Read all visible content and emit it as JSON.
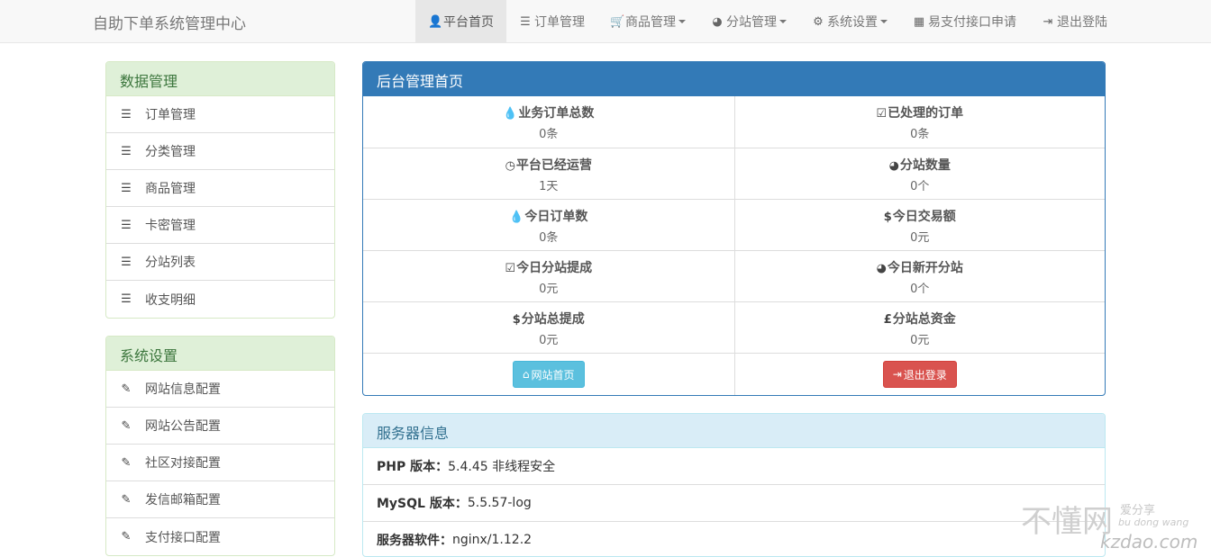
{
  "brand": "自助下单系统管理中心",
  "nav": [
    {
      "label": "平台首页",
      "icon": "user-icon",
      "glyph": "👤",
      "active": true,
      "dropdown": false
    },
    {
      "label": "订单管理",
      "icon": "list-icon",
      "glyph": "☰",
      "active": false,
      "dropdown": false
    },
    {
      "label": "商品管理",
      "icon": "shopping-cart-icon",
      "glyph": "🛒",
      "active": false,
      "dropdown": true
    },
    {
      "label": "分站管理",
      "icon": "globe-icon",
      "glyph": "◕",
      "active": false,
      "dropdown": true
    },
    {
      "label": "系统设置",
      "icon": "cog-icon",
      "glyph": "⚙",
      "active": false,
      "dropdown": true
    },
    {
      "label": "易支付接口申请",
      "icon": "th-large-icon",
      "glyph": "▦",
      "active": false,
      "dropdown": false
    },
    {
      "label": "退出登陆",
      "icon": "log-out-icon",
      "glyph": "⇥",
      "active": false,
      "dropdown": false
    }
  ],
  "sidebar": {
    "data_panel": {
      "title": "数据管理",
      "icon": "list-icon",
      "items": [
        "订单管理",
        "分类管理",
        "商品管理",
        "卡密管理",
        "分站列表",
        "收支明细"
      ]
    },
    "settings_panel": {
      "title": "系统设置",
      "icon": "edit-icon",
      "items": [
        "网站信息配置",
        "网站公告配置",
        "社区对接配置",
        "发信邮箱配置",
        "支付接口配置"
      ]
    }
  },
  "main": {
    "title": "后台管理首页",
    "stats": [
      [
        {
          "icon": "tint-icon",
          "glyph": "💧",
          "label": "业务订单总数",
          "value": "0条"
        },
        {
          "icon": "check-icon",
          "glyph": "☑",
          "label": "已处理的订单",
          "value": "0条"
        }
      ],
      [
        {
          "icon": "clock-icon",
          "glyph": "◷",
          "label": "平台已经运营",
          "value": "1天"
        },
        {
          "icon": "globe-icon",
          "glyph": "◕",
          "label": "分站数量",
          "value": "0个"
        }
      ],
      [
        {
          "icon": "tint-icon",
          "glyph": "💧",
          "label": "今日订单数",
          "value": "0条"
        },
        {
          "icon": "usd-icon",
          "glyph": "$",
          "label": "今日交易额",
          "value": "0元"
        }
      ],
      [
        {
          "icon": "check-icon",
          "glyph": "☑",
          "label": "今日分站提成",
          "value": "0元"
        },
        {
          "icon": "globe-icon",
          "glyph": "◕",
          "label": "今日新开分站",
          "value": "0个"
        }
      ],
      [
        {
          "icon": "usd-icon",
          "glyph": "$",
          "label": "分站总提成",
          "value": "0元"
        },
        {
          "icon": "gbp-icon",
          "glyph": "£",
          "label": "分站总资金",
          "value": "0元"
        }
      ]
    ],
    "home_button": "网站首页",
    "logout_button": "退出登录"
  },
  "server": {
    "title": "服务器信息",
    "rows": [
      {
        "key": "PHP 版本：",
        "value": "5.4.45 非线程安全"
      },
      {
        "key": "MySQL 版本：",
        "value": "5.5.57-log"
      },
      {
        "key": "服务器软件：",
        "value": "nginx/1.12.2"
      }
    ]
  },
  "watermark": {
    "main": "不懂网",
    "sub1": "爱分享",
    "sub2": "bu dong wang",
    "sub3": "kzdao.com"
  }
}
